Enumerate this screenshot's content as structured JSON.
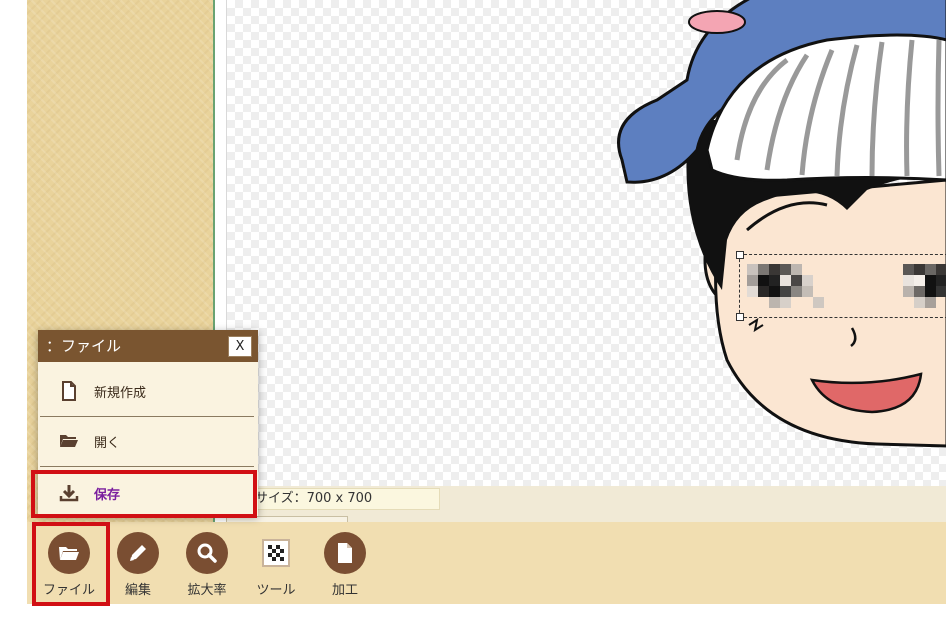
{
  "sidebar": {},
  "status": {
    "size_text": "サイズ：700 x 700"
  },
  "toolbar": {
    "tools": [
      {
        "label": "ファイル",
        "icon": "folder-open-icon"
      },
      {
        "label": "編集",
        "icon": "pencil-icon"
      },
      {
        "label": "拡大率",
        "icon": "magnifier-icon"
      },
      {
        "label": "ツール",
        "icon": "checker-icon"
      },
      {
        "label": "加工",
        "icon": "document-icon"
      }
    ]
  },
  "file_menu": {
    "title": "：ファイル",
    "close_label": "X",
    "items": [
      {
        "label": "新規作成",
        "icon": "new-file-icon"
      },
      {
        "label": "開く",
        "icon": "folder-open-icon"
      },
      {
        "label": "保存",
        "icon": "download-icon"
      }
    ]
  },
  "colors": {
    "highlight": "#d10f14",
    "menu_header": "#7a5530",
    "tool_icon": "#7a4e32",
    "toolbar_bg": "#f1deb1",
    "sidebar_bg": "#e9d39b"
  }
}
